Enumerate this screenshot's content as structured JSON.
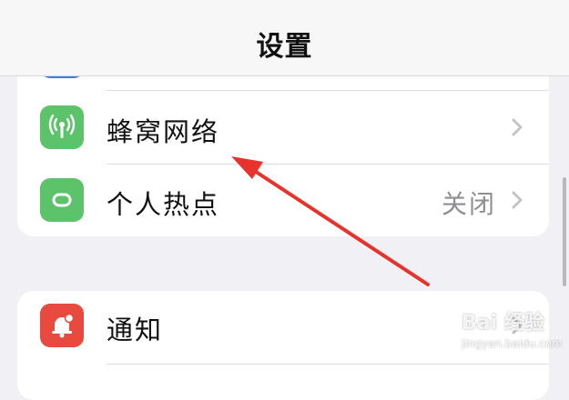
{
  "nav": {
    "title": "设置"
  },
  "network_group": {
    "rows": [
      {
        "label": "蜂窝网络",
        "icon": "cellular-antenna-icon",
        "icon_color": "#5cc36a"
      },
      {
        "label": "个人热点",
        "value": "关闭",
        "icon": "hotspot-link-icon",
        "icon_color": "#5cc36a"
      }
    ]
  },
  "system_group": {
    "rows": [
      {
        "label": "通知",
        "icon": "notification-bell-icon",
        "icon_color": "#e84a3f"
      }
    ]
  },
  "annotation": {
    "arrow_color": "#e8322b",
    "points_to": "蜂窝网络"
  },
  "watermark": {
    "brand": "Bai 经验",
    "url": "jingyan.baidu.com"
  }
}
